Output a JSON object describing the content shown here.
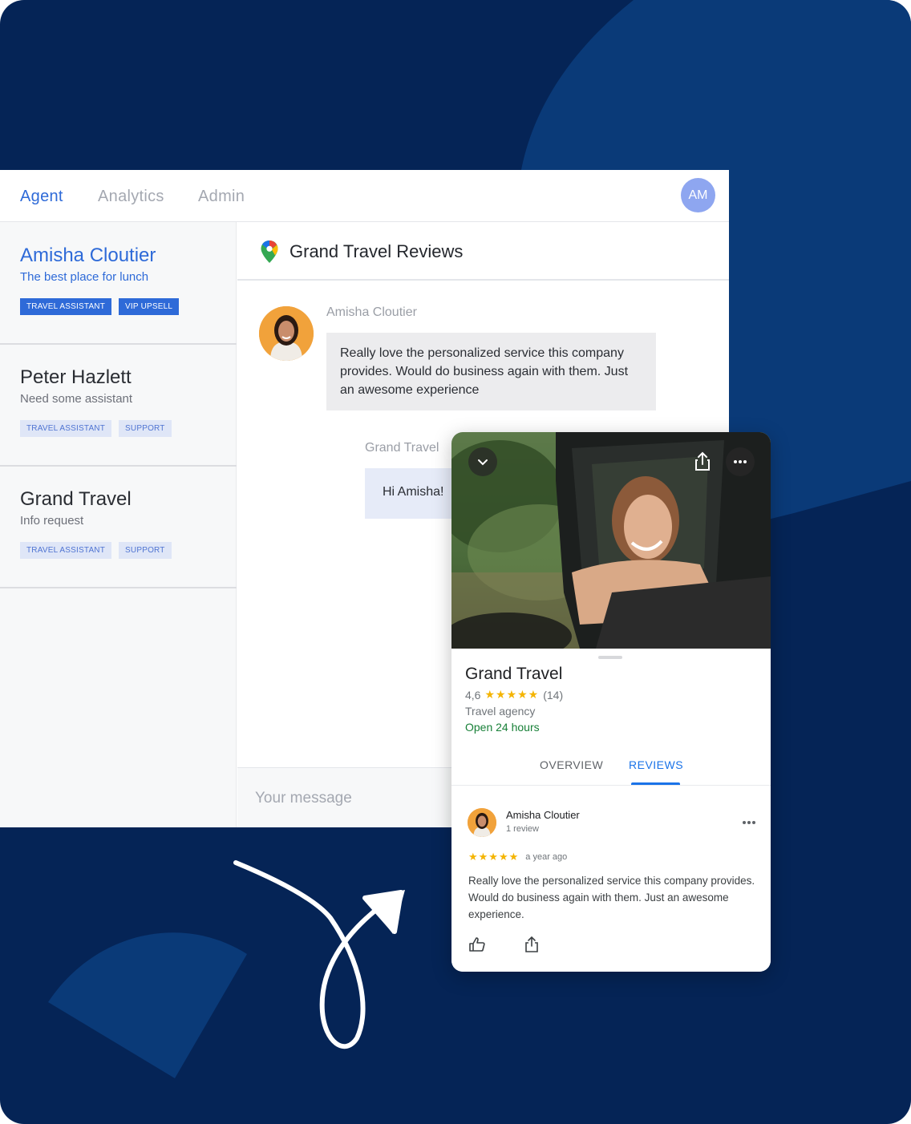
{
  "nav": {
    "tabs": [
      "Agent",
      "Analytics",
      "Admin"
    ],
    "active_tab": "Agent",
    "user_initials": "AM"
  },
  "conversations": [
    {
      "name": "Amisha Cloutier",
      "subtitle": "The best place for lunch",
      "tags": [
        "TRAVEL ASSISTANT",
        "VIP UPSELL"
      ],
      "active": true
    },
    {
      "name": "Peter Hazlett",
      "subtitle": "Need some assistant",
      "tags": [
        "TRAVEL ASSISTANT",
        "SUPPORT"
      ],
      "active": false
    },
    {
      "name": "Grand Travel",
      "subtitle": "Info request",
      "tags": [
        "TRAVEL ASSISTANT",
        "SUPPORT"
      ],
      "active": false
    }
  ],
  "chat": {
    "title": "Grand Travel Reviews",
    "messages": [
      {
        "sender": "Amisha Cloutier",
        "text": "Really love the personalized service this company provides. Would do business again with them. Just an awesome experience"
      },
      {
        "sender": "Grand Travel",
        "text": "Hi Amisha!"
      }
    ],
    "input_placeholder": "Your message"
  },
  "place_card": {
    "name": "Grand Travel",
    "rating": "4,6",
    "review_count": "(14)",
    "stars": "★★★★★",
    "category": "Travel agency",
    "hours": "Open 24 hours",
    "tabs": [
      "OVERVIEW",
      "REVIEWS"
    ],
    "active_tab": "REVIEWS",
    "review": {
      "author": "Amisha Cloutier",
      "author_meta": "1 review",
      "stars": "★★★★★",
      "time": "a year ago",
      "text": "Really love the personalized service this company provides. Would do business again with them. Just an awesome experience."
    }
  },
  "colors": {
    "background": "#052456",
    "accent": "#2e6ad8",
    "google_blue": "#1a73e8",
    "star": "#f4b400",
    "open_green": "#188038"
  }
}
